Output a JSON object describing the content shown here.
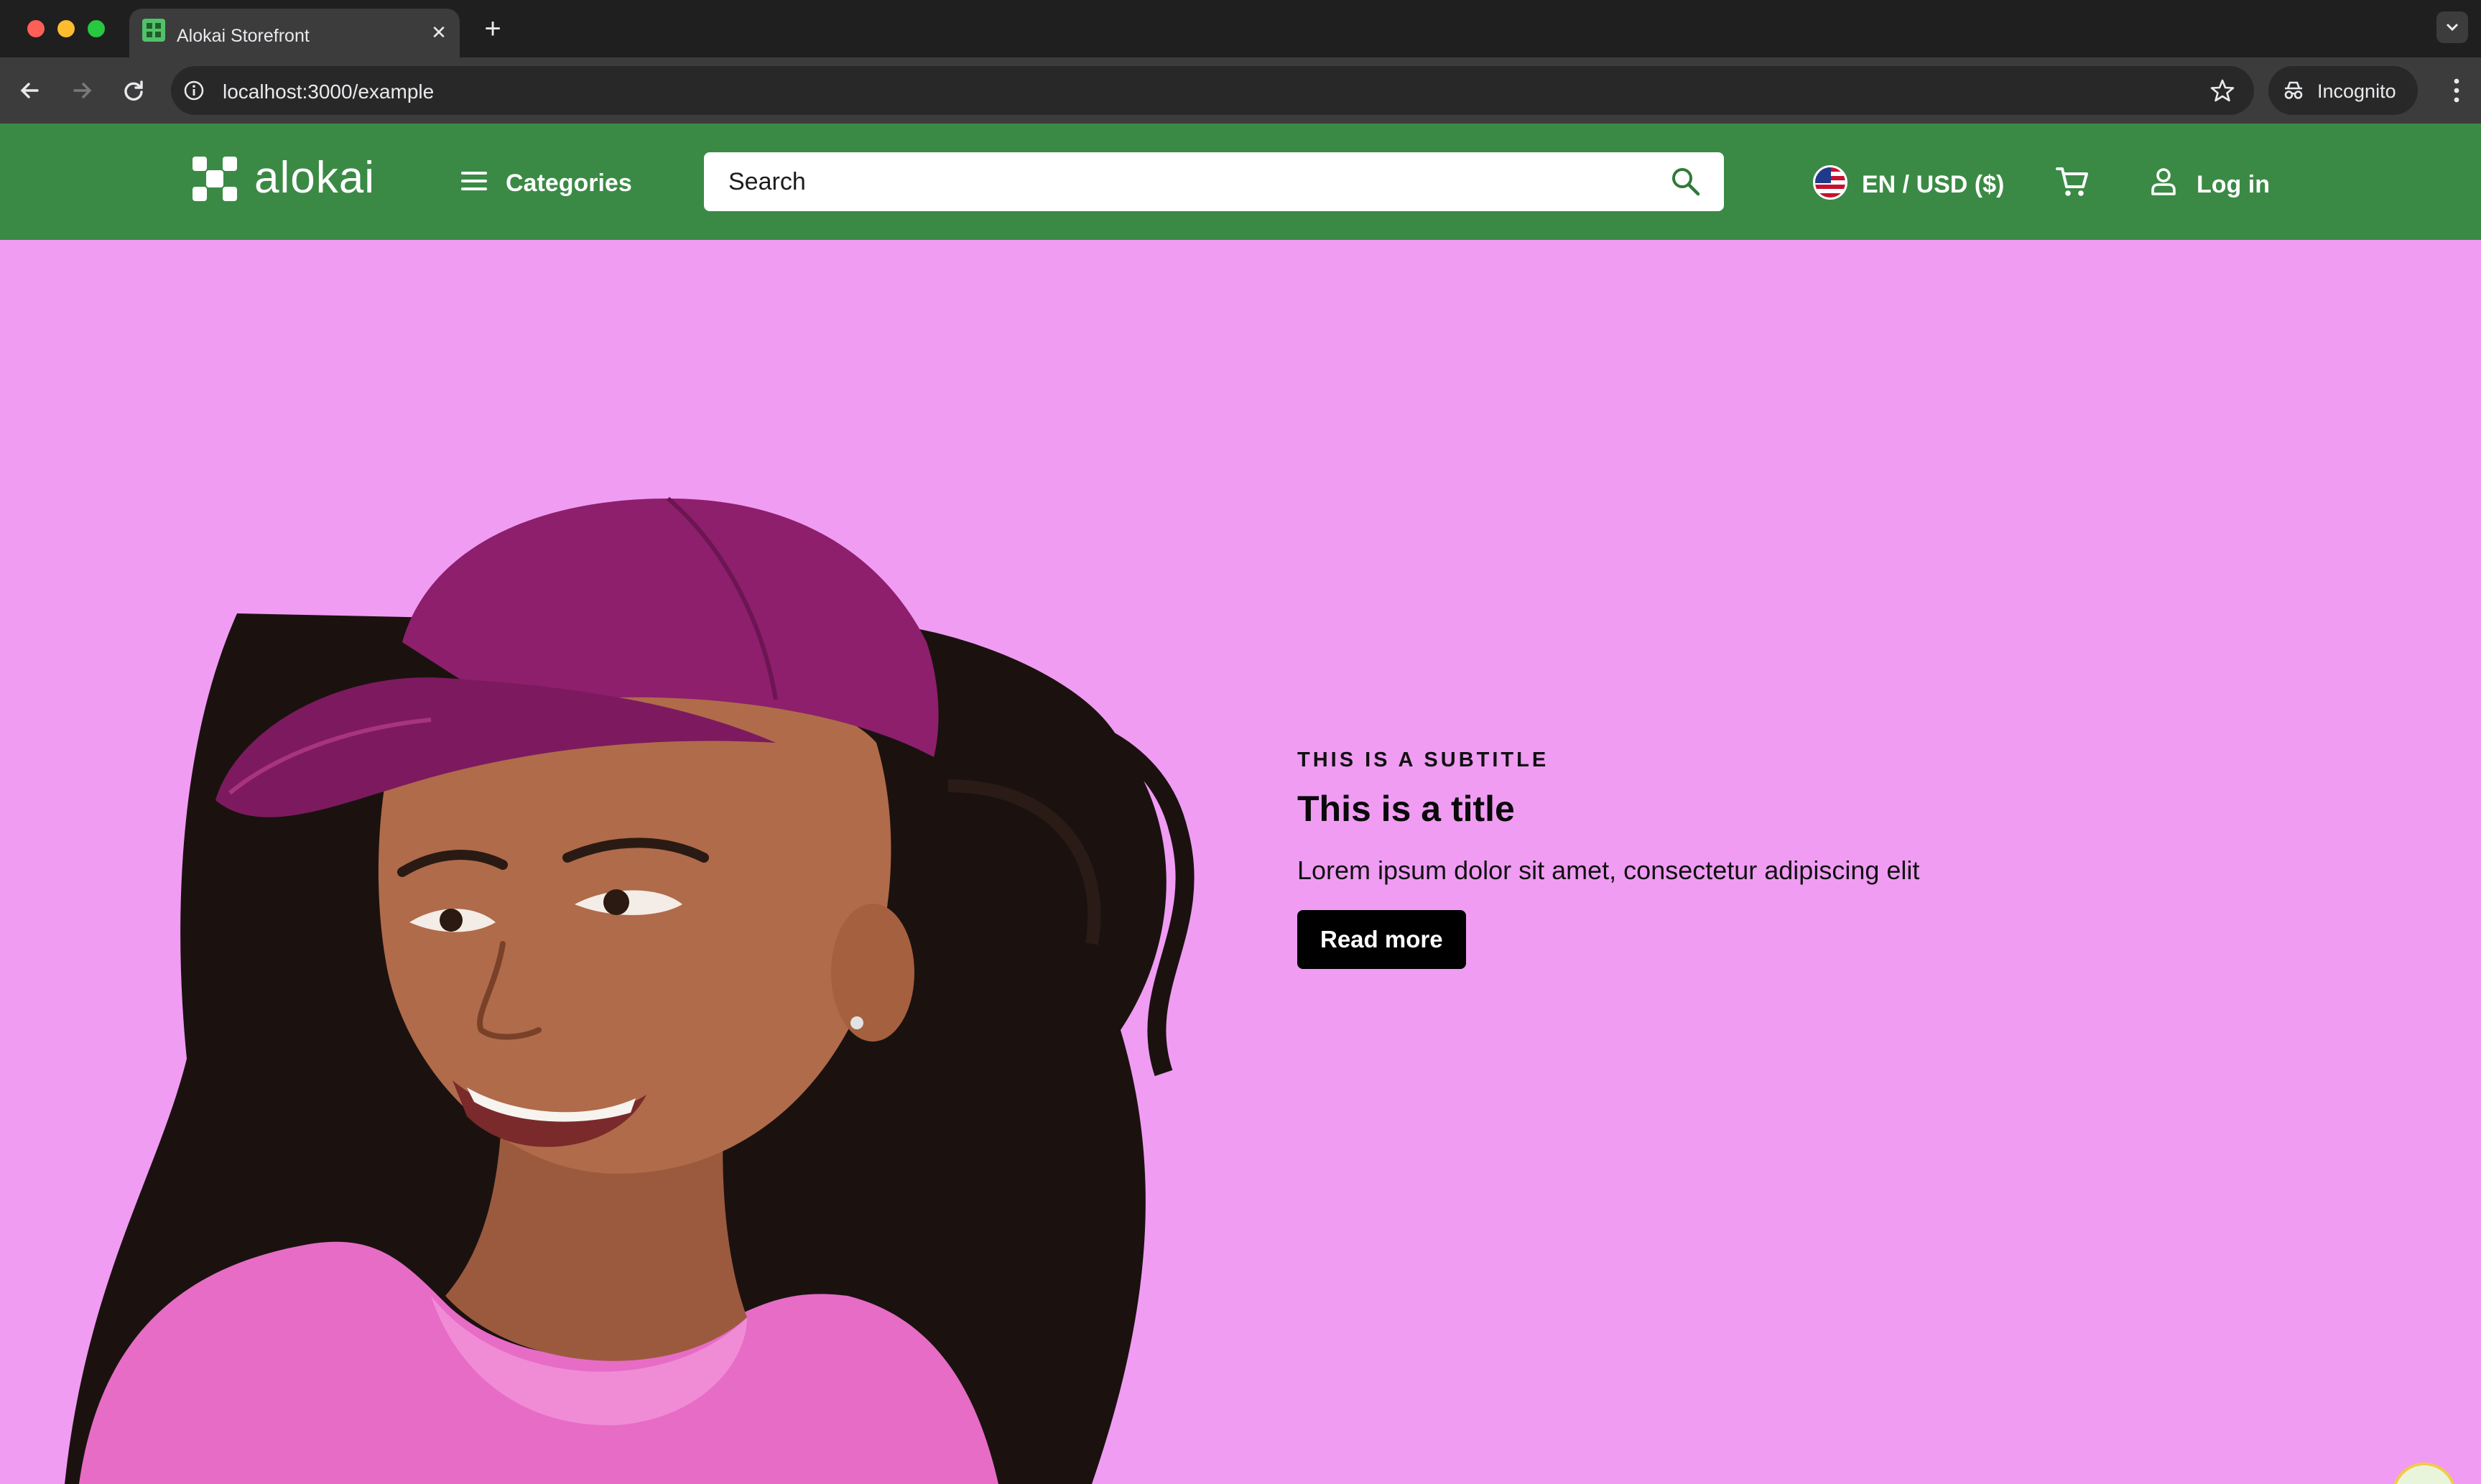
{
  "browser": {
    "tab_title": "Alokai Storefront",
    "url": "localhost:3000/example",
    "profile_label": "Incognito"
  },
  "header": {
    "logo_text": "alokai",
    "categories_label": "Categories",
    "search_placeholder": "Search",
    "locale_label": "EN / USD ($)",
    "login_label": "Log in",
    "background_color": "#3a8a45"
  },
  "hero": {
    "subtitle": "THIS IS A SUBTITLE",
    "title": "This is a title",
    "description": "Lorem ipsum dolor sit amet, consectetur adipiscing elit",
    "button_label": "Read more",
    "background_color": "#f09cf3"
  }
}
